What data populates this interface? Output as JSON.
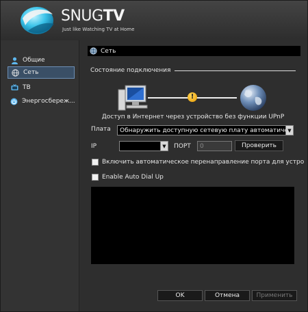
{
  "header": {
    "brand_snug": "SNUG",
    "brand_tv": "TV",
    "tagline": "Just like Watching TV at Home"
  },
  "sidebar": {
    "items": [
      {
        "label": "Общие",
        "icon": "user-icon"
      },
      {
        "label": "Сеть",
        "icon": "globe-icon"
      },
      {
        "label": "ТВ",
        "icon": "tv-icon"
      },
      {
        "label": "Энергосбереж...",
        "icon": "power-icon"
      }
    ],
    "selected": "Сеть"
  },
  "main": {
    "title": "Сеть",
    "section_title": "Состояние подключения",
    "status_text": "Доступ в Интернет через устройство без функции UPnP",
    "adapter_label": "Плата",
    "adapter_value": "Обнаружить доступную сетевую плату автоматически",
    "ip_label": "IP",
    "ip_value": "",
    "port_label": "ПОРТ",
    "port_value": "0",
    "check_button": "Проверить",
    "auto_forward_label": "Включить автоматическое перенаправление порта для устро",
    "auto_forward_checked": false,
    "auto_dial_label": "Enable Auto Dial Up",
    "auto_dial_checked": false,
    "warn_symbol": "!"
  },
  "footer": {
    "ok": "OK",
    "cancel": "Отмена",
    "apply": "Применить"
  },
  "colors": {
    "selection_bg": "#3a4f66",
    "selection_border": "#6d8fb5",
    "warning": "#f0a800"
  }
}
